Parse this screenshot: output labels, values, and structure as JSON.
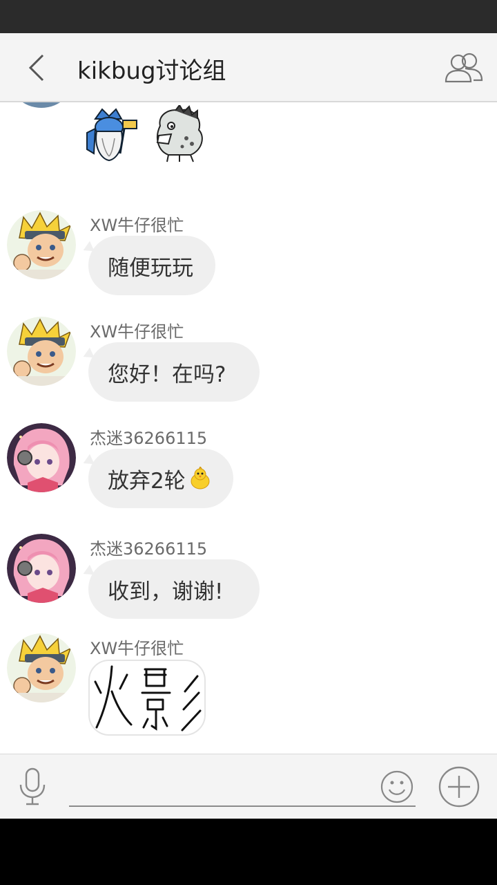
{
  "header": {
    "title": "kikbug讨论组"
  },
  "messages": [
    {
      "sender": "XW牛仔很忙",
      "text": "随便玩玩"
    },
    {
      "sender": "XW牛仔很忙",
      "text": "您好！在吗?"
    },
    {
      "sender": "杰迷36266115",
      "text": "放弃2轮"
    },
    {
      "sender": "杰迷36266115",
      "text": "收到，谢谢!"
    },
    {
      "sender": "XW牛仔很忙",
      "sticker_text": "火影"
    }
  ],
  "input": {
    "value": "",
    "placeholder": ""
  },
  "icons": {
    "back": "chevron-left-icon",
    "group": "group-members-icon",
    "mic": "microphone-icon",
    "emoji": "smiley-icon",
    "plus": "plus-icon",
    "chick": "chick-emoji"
  },
  "colors": {
    "header_bg": "#f4f4f4",
    "bubble_bg": "#efefef",
    "statusbar_bg": "#2b2b2b"
  }
}
